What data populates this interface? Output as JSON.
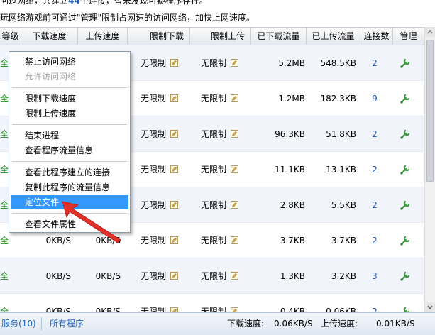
{
  "notice": {
    "line1_pre": "问过网络，共建立",
    "line1_count": "44",
    "line1_post": "个连接，智未发现可疑程序存在。",
    "line2": "玩网络游戏前可通过\"管理\"限制占网速的访问网络，加快上网速度。"
  },
  "columns": [
    "等级",
    "下载速度",
    "上传速度",
    "限制下载",
    "限制上传",
    "已下载流量",
    "已上传流量",
    "连接数",
    "管理"
  ],
  "rows": [
    {
      "level": "全",
      "down": "",
      "up": "",
      "dl_limit": "无限制",
      "ul_limit": "无限制",
      "downloaded": "5.2MB",
      "uploaded": "548.5KB",
      "connections": "2"
    },
    {
      "level": "全",
      "down": "",
      "up": "",
      "dl_limit": "无限制",
      "ul_limit": "无限制",
      "downloaded": "1.2MB",
      "uploaded": "182.3KB",
      "connections": "9"
    },
    {
      "level": "全",
      "down": "",
      "up": "",
      "dl_limit": "无限制",
      "ul_limit": "无限制",
      "downloaded": "96.3KB",
      "uploaded": "51.8KB",
      "connections": "2"
    },
    {
      "level": "全",
      "down": "",
      "up": "",
      "dl_limit": "无限制",
      "ul_limit": "无限制",
      "downloaded": "11.1KB",
      "uploaded": "13.1KB",
      "connections": "2"
    },
    {
      "level": "全",
      "down": "",
      "up": "",
      "dl_limit": "无限制",
      "ul_limit": "无限制",
      "downloaded": "2.8KB",
      "uploaded": "5.5KB",
      "connections": "2"
    },
    {
      "level": "全",
      "down": "0KB/S",
      "up": "0KB/S",
      "dl_limit": "无限制",
      "ul_limit": "无限制",
      "downloaded": "3.7KB",
      "uploaded": "3.7KB",
      "connections": "2"
    },
    {
      "level": "全",
      "down": "0KB/S",
      "up": "0KB/S",
      "dl_limit": "无限制",
      "ul_limit": "无限制",
      "downloaded": "1.3KB",
      "uploaded": "3.2KB",
      "connections": "3"
    },
    {
      "level": "全",
      "down": "0KB/S",
      "up": "0KB/S",
      "dl_limit": "无限制",
      "ul_limit": "无限制",
      "downloaded": "0.4KB",
      "uploaded": "0.06KB",
      "connections": "2"
    }
  ],
  "context_menu": [
    {
      "label": "禁止访问网络",
      "disabled": false,
      "selected": false
    },
    {
      "label": "允许访问网络",
      "disabled": true,
      "selected": false
    },
    {
      "separator": true
    },
    {
      "label": "限制下载速度",
      "disabled": false,
      "selected": false
    },
    {
      "label": "限制上传速度",
      "disabled": false,
      "selected": false
    },
    {
      "separator": true
    },
    {
      "label": "结束进程",
      "disabled": false,
      "selected": false
    },
    {
      "label": "查看程序流量信息",
      "disabled": false,
      "selected": false
    },
    {
      "separator": true
    },
    {
      "label": "查看此程序建立的连接",
      "disabled": false,
      "selected": false
    },
    {
      "label": "复制此程序的流量信息",
      "disabled": false,
      "selected": false
    },
    {
      "label": "定位文件",
      "disabled": false,
      "selected": true
    },
    {
      "separator": true
    },
    {
      "label": "查看文件属性",
      "disabled": false,
      "selected": false
    }
  ],
  "status": {
    "services": "服务(10)",
    "all_programs": "所有程序",
    "down_label": "下载速度:",
    "down_value": "0.06KB/S",
    "up_label": "上传速度:",
    "up_value": "0.01KB/S"
  },
  "icons": {
    "edit": "pencil-icon",
    "manage": "wrench-icon",
    "pointer": "red-arrow-annotation"
  },
  "colors": {
    "menu_highlight": "#3399ff",
    "link": "#1f5fbf",
    "level_green": "#1a8a1a",
    "annotation_red": "#e0322a"
  }
}
